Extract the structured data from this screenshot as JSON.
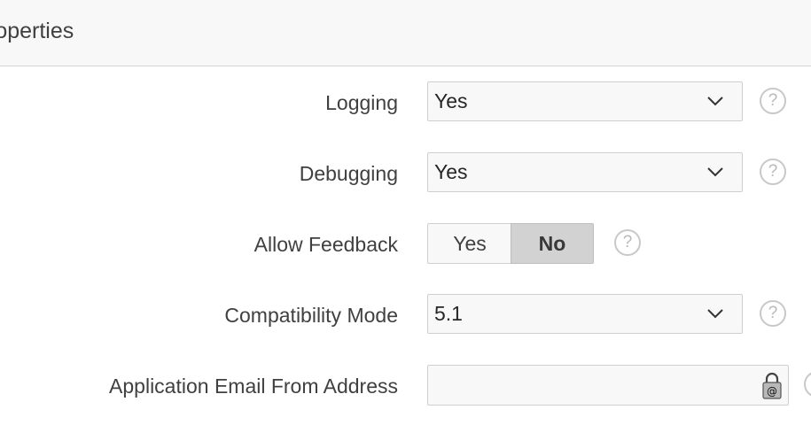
{
  "region": {
    "title": "roperties"
  },
  "fields": {
    "logging": {
      "label": "Logging",
      "value": "Yes"
    },
    "debugging": {
      "label": "Debugging",
      "value": "Yes"
    },
    "allow_feedback": {
      "label": "Allow Feedback",
      "option_yes": "Yes",
      "option_no": "No",
      "selected": "No"
    },
    "compatibility_mode": {
      "label": "Compatibility Mode",
      "value": "5.1"
    },
    "application_email": {
      "label": "Application Email From Address",
      "value": ""
    }
  },
  "icons": {
    "help": "?",
    "chevron": "chevron-down-icon",
    "lock": "lock-at-icon"
  },
  "colors": {
    "header_bg": "#f8f8f8",
    "selected_toggle": "#d2d2d2",
    "field_border": "#cfcfcf"
  }
}
